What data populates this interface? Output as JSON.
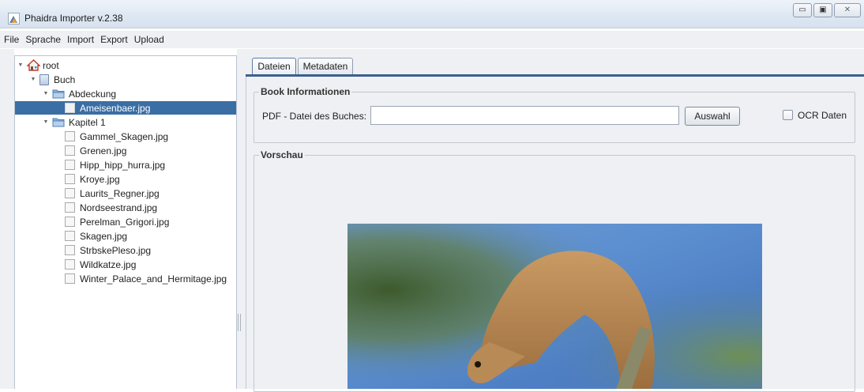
{
  "window": {
    "title": "Phaidra Importer v.2.38",
    "minimize_glyph": "▭",
    "maximize_glyph": "▣",
    "close_glyph": "✕"
  },
  "menu": {
    "items": [
      "File",
      "Sprache",
      "Import",
      "Export",
      "Upload"
    ]
  },
  "tree": {
    "root": "root",
    "book": "Buch",
    "folders": [
      {
        "label": "Abdeckung",
        "files": [
          "Ameisenbaer.jpg"
        ]
      },
      {
        "label": "Kapitel 1",
        "files": [
          "Gammel_Skagen.jpg",
          "Grenen.jpg",
          "Hipp_hipp_hurra.jpg",
          "Kroye.jpg",
          "Laurits_Regner.jpg",
          "Nordseestrand.jpg",
          "Perelman_Grigori.jpg",
          "Skagen.jpg",
          "StrbskePleso.jpg",
          "Wildkatze.jpg",
          "Winter_Palace_and_Hermitage.jpg"
        ]
      }
    ],
    "selected_file": "Ameisenbaer.jpg"
  },
  "tabs": [
    "Dateien",
    "Metadaten"
  ],
  "active_tab": "Dateien",
  "book_info": {
    "group_title": "Book Informationen",
    "pdf_label": "PDF - Datei des Buches:",
    "pdf_value": "",
    "select_button": "Auswahl",
    "ocr_label": "OCR Daten",
    "ocr_checked": false
  },
  "preview": {
    "group_title": "Vorschau"
  },
  "colors": {
    "selection": "#3a6ea5",
    "tab_accent": "#3d5f8c",
    "panel_bg": "#eef0f3"
  }
}
